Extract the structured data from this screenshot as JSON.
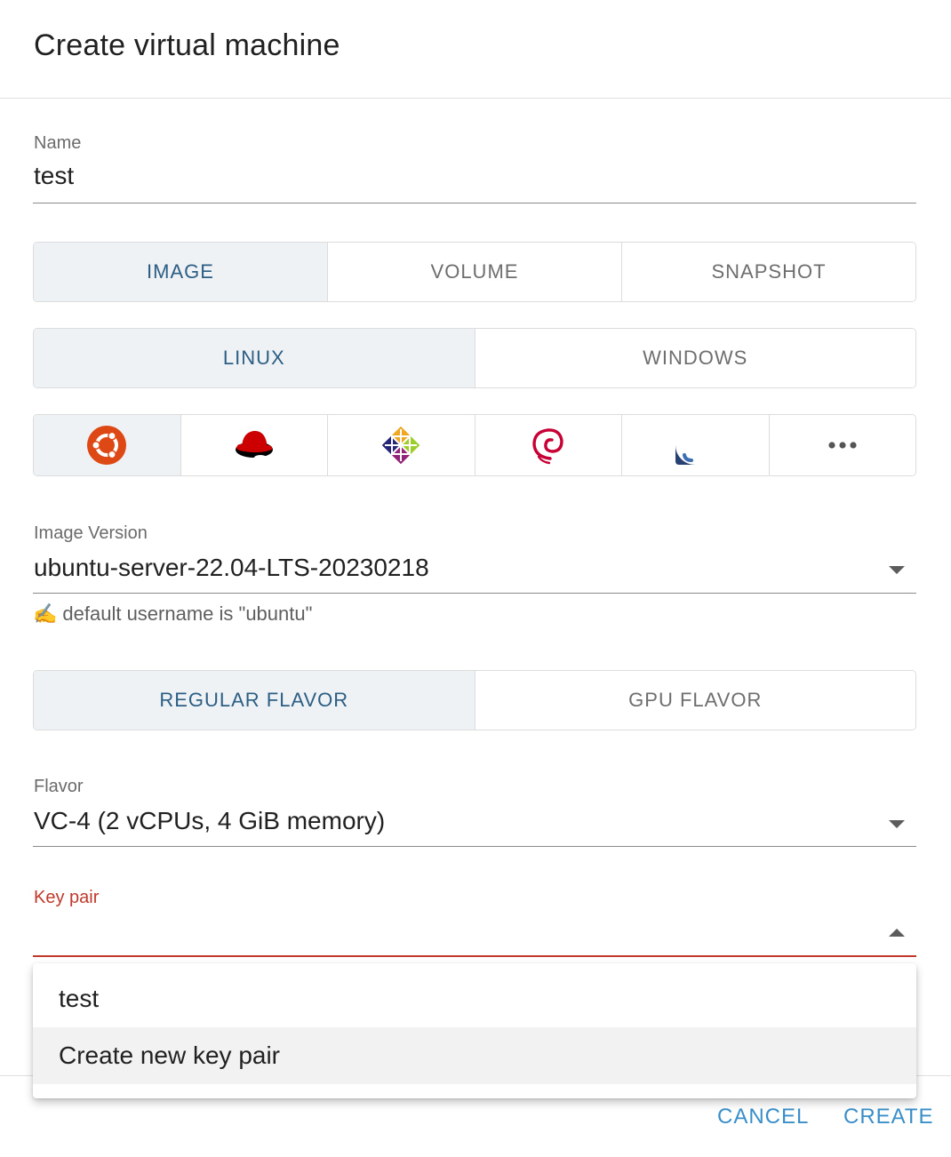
{
  "dialog": {
    "title": "Create virtual machine"
  },
  "name_field": {
    "label": "Name",
    "value": "test"
  },
  "source_tabs": [
    {
      "label": "IMAGE",
      "active": true
    },
    {
      "label": "VOLUME",
      "active": false
    },
    {
      "label": "SNAPSHOT",
      "active": false
    }
  ],
  "os_type_tabs": [
    {
      "label": "LINUX",
      "active": true
    },
    {
      "label": "WINDOWS",
      "active": false
    }
  ],
  "os_distros": [
    {
      "icon": "ubuntu-logo-icon",
      "active": true
    },
    {
      "icon": "redhat-logo-icon",
      "active": false
    },
    {
      "icon": "centos-logo-icon",
      "active": false
    },
    {
      "icon": "debian-logo-icon",
      "active": false
    },
    {
      "icon": "fedora-logo-icon",
      "active": false
    },
    {
      "icon": "more-icon",
      "active": false
    }
  ],
  "image_version": {
    "label": "Image Version",
    "value": "ubuntu-server-22.04-LTS-20230218",
    "hint_icon": "✍️",
    "hint": "default username is \"ubuntu\""
  },
  "flavor_tabs": [
    {
      "label": "REGULAR FLAVOR",
      "active": true
    },
    {
      "label": "GPU FLAVOR",
      "active": false
    }
  ],
  "flavor": {
    "label": "Flavor",
    "value": "VC-4 (2 vCPUs, 4 GiB memory)"
  },
  "key_pair": {
    "label": "Key pair",
    "value": "",
    "options": [
      "test",
      "Create new key pair"
    ],
    "highlighted_index": 1
  },
  "footer": {
    "cancel_label": "CANCEL",
    "create_label": "CREATE"
  },
  "colors": {
    "accent": "#2c5e84",
    "active_bg": "#eef2f5",
    "error": "#c0392b",
    "action": "#3a8fc9"
  }
}
